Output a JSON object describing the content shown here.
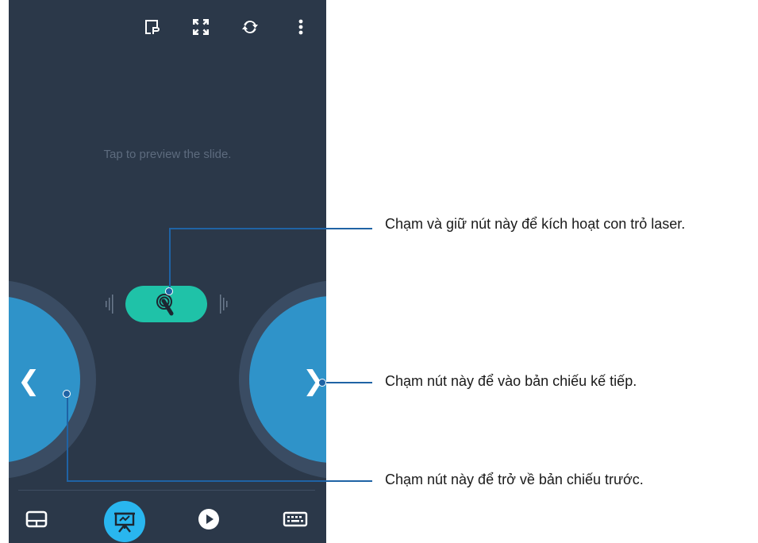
{
  "screen": {
    "preview_hint": "Tap to preview the slide."
  },
  "topbar": {
    "icons": [
      "presentation-pointer-icon",
      "fullscreen-icon",
      "refresh-icon",
      "more-vertical-icon"
    ]
  },
  "controls": {
    "laser_button_icon": "laser-pointer-icon",
    "prev_symbol": "❮",
    "next_symbol": "❯"
  },
  "bottom_nav": {
    "items": [
      "touchpad-icon",
      "presentation-icon",
      "play-icon",
      "keyboard-icon"
    ],
    "active_index": 1
  },
  "callouts": {
    "laser": "Chạm và giữ nút này để kích hoạt con trỏ laser.",
    "next": "Chạm nút này để vào bản chiếu kế tiếp.",
    "prev": "Chạm nút này để trở về bản chiếu trước."
  },
  "colors": {
    "phone_bg": "#2b3849",
    "laser_button": "#1fc2a8",
    "nav_button": "#2f93c9",
    "active_tab": "#29b6ef",
    "leader_line": "#1f63a5"
  }
}
